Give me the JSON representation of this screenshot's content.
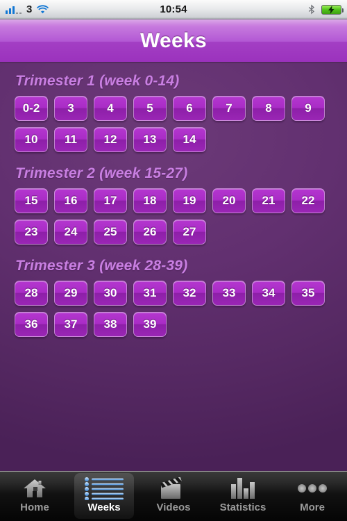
{
  "status_bar": {
    "signal_label": "3",
    "signal_bars_filled": 3,
    "signal_bars_empty": 2,
    "wifi_icon": "wifi-icon",
    "time": "10:54",
    "bluetooth_icon": "bluetooth-icon",
    "battery_icon": "battery-charging-icon",
    "battery_color": "#4fc21a"
  },
  "navbar": {
    "title": "Weeks",
    "accent": "#b258d4"
  },
  "content": {
    "background_color": "#623070",
    "sections": [
      {
        "title": "Trimester 1 (week 0-14)",
        "rows": [
          [
            "0-2",
            "3",
            "4",
            "5",
            "6",
            "7",
            "8",
            "9"
          ],
          [
            "10",
            "11",
            "12",
            "13",
            "14"
          ]
        ]
      },
      {
        "title": "Trimester 2 (week 15-27)",
        "rows": [
          [
            "15",
            "16",
            "17",
            "18",
            "19",
            "20",
            "21",
            "22"
          ],
          [
            "23",
            "24",
            "25",
            "26",
            "27"
          ]
        ]
      },
      {
        "title": "Trimester 3 (week 28-39)",
        "rows": [
          [
            "28",
            "29",
            "30",
            "31",
            "32",
            "33",
            "34",
            "35"
          ],
          [
            "36",
            "37",
            "38",
            "39"
          ]
        ]
      }
    ]
  },
  "tabbar": {
    "active_index": 1,
    "tabs": [
      {
        "label": "Home",
        "icon": "house-icon"
      },
      {
        "label": "Weeks",
        "icon": "list-icon"
      },
      {
        "label": "Videos",
        "icon": "film-clapper-icon"
      },
      {
        "label": "Statistics",
        "icon": "bar-chart-icon"
      },
      {
        "label": "More",
        "icon": "ellipsis-icon"
      }
    ]
  }
}
